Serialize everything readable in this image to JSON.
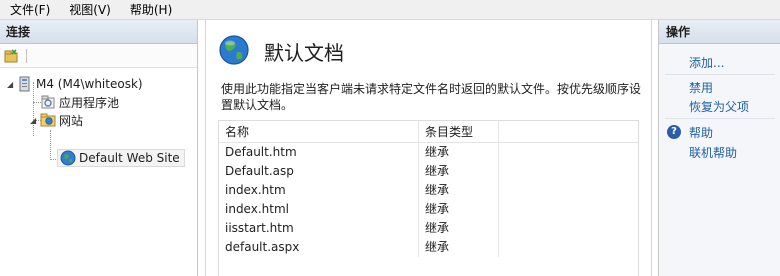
{
  "menubar": {
    "items": [
      "文件(F)",
      "视图(V)",
      "帮助(H)"
    ]
  },
  "connections": {
    "header": "连接",
    "tree": {
      "server": "M4 (M4\\whiteosk)",
      "app_pools": "应用程序池",
      "sites": "网站",
      "site": "Default Web Site"
    }
  },
  "main": {
    "title": "默认文档",
    "description": "使用此功能指定当客户端未请求特定文件名时返回的默认文件。按优先级顺序设置默认文档。",
    "columns": [
      "名称",
      "条目类型"
    ],
    "rows": [
      {
        "name": "Default.htm",
        "type": "继承"
      },
      {
        "name": "Default.asp",
        "type": "继承"
      },
      {
        "name": "index.htm",
        "type": "继承"
      },
      {
        "name": "index.html",
        "type": "继承"
      },
      {
        "name": "iisstart.htm",
        "type": "继承"
      },
      {
        "name": "default.aspx",
        "type": "继承"
      }
    ]
  },
  "actions": {
    "header": "操作",
    "add": "添加...",
    "disable": "禁用",
    "revert": "恢复为父项",
    "help": "帮助",
    "online_help": "联机帮助"
  },
  "colors": {
    "link": "#1f5fa8",
    "header_bg": "#dfe6f0"
  }
}
